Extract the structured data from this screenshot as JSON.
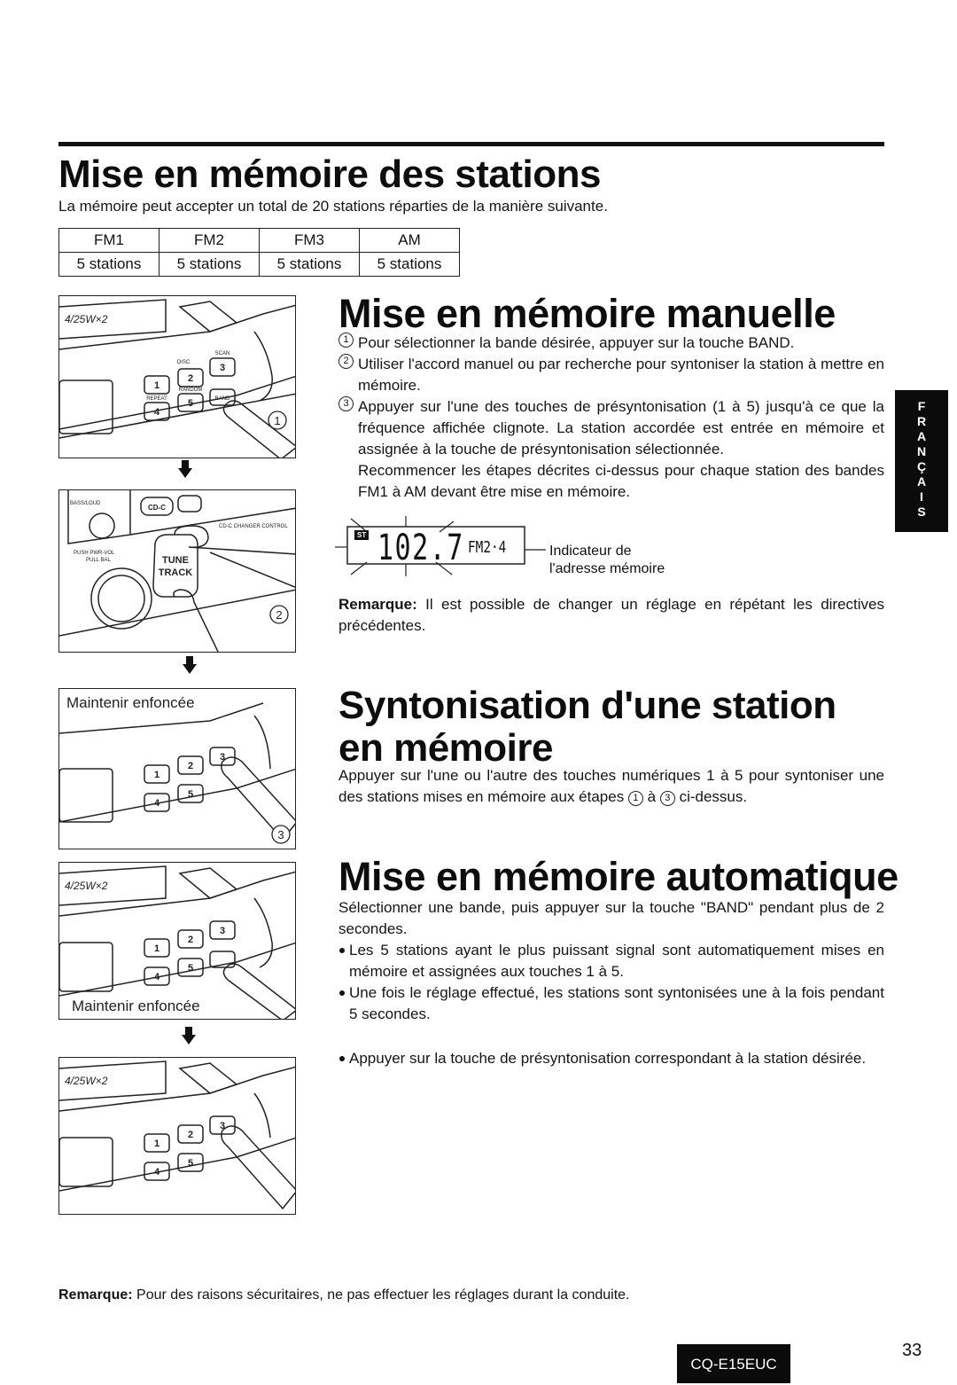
{
  "page": {
    "number": "33",
    "model_badge": "CQ-E15EUC",
    "language_tab": [
      "F",
      "R",
      "A",
      "N",
      "Ç",
      "A",
      "I",
      "S"
    ]
  },
  "section_stations": {
    "title": "Mise en mémoire des stations",
    "intro": "La mémoire peut accepter un total de 20 stations réparties de la manière suivante.",
    "table": {
      "headers": [
        "FM1",
        "FM2",
        "FM3",
        "AM"
      ],
      "values": [
        "5 stations",
        "5 stations",
        "5 stations",
        "5 stations"
      ]
    }
  },
  "section_manual": {
    "title": "Mise en mémoire manuelle",
    "steps": [
      {
        "num": "1",
        "text": "Pour sélectionner la bande désirée, appuyer sur la touche BAND."
      },
      {
        "num": "2",
        "text": "Utiliser l'accord manuel ou par recherche pour syntoniser la station à mettre en mémoire."
      },
      {
        "num": "3",
        "text": "Appuyer sur l'une des touches de présyntonisation  (1 à 5) jusqu'à ce que la fréquence affichée clignote. La station accordée est entrée en mémoire et assignée à la touche de présyntonisation sélectionnée."
      }
    ],
    "repeat_note": "Recommencer les étapes décrites ci-dessus pour chaque station des bandes FM1 à AM devant être mise en mémoire.",
    "display": {
      "st_indicator": "ST",
      "frequency": "102.7",
      "band_preset": "FM2·4",
      "callout_line1": "Indicateur de",
      "callout_line2": "l'adresse mémoire"
    },
    "remark_label": "Remarque:",
    "remark_text": " Il est possible de changer un réglage en répétant les directives précédentes."
  },
  "section_recall": {
    "title": "Syntonisation d'une station en mémoire",
    "text_before": "Appuyer sur l'une ou l'autre des touches numériques 1 à 5 pour syntoniser une des stations mises en mémoire aux étapes ",
    "step_from": "1",
    "text_middle": " à ",
    "step_to": "3",
    "text_after": " ci-dessus."
  },
  "section_auto": {
    "title": "Mise en mémoire automatique",
    "intro": "Sélectionner une bande, puis appuyer sur la touche \"BAND\" pendant plus de 2 secondes.",
    "bullets": [
      "Les 5 stations ayant le plus puissant signal sont automatiquement mises en mémoire et assignées aux touches 1 à 5.",
      "Une fois le réglage effectué, les stations sont syntonisées une à la fois pendant 5 secondes."
    ],
    "bullets2": [
      "Appuyer sur la touche de présyntonisation correspondant à la station désirée."
    ]
  },
  "footer_remark": {
    "label": "Remarque:",
    "text": " Pour des raisons sécuritaires, ne pas effectuer les réglages durant la conduite."
  },
  "illustrations": [
    {
      "step": "1",
      "caption": "",
      "keys": [
        "1",
        "2",
        "3",
        "4",
        "5"
      ],
      "key_labels": [
        "SCAN",
        "REPEAT",
        "RANDOM",
        "BAND",
        "DISC"
      ],
      "display_text": "4/25W×2"
    },
    {
      "step": "2",
      "caption": "",
      "labels": [
        "BASS/LOUD",
        "PUSH PWR-VOL",
        "PULL BAL",
        "TUNE",
        "TRACK",
        "CD-C",
        "CD-C CHANGER CONTROL"
      ]
    },
    {
      "step": "3",
      "caption": "Maintenir enfoncée",
      "keys": [
        "1",
        "2",
        "3",
        "4",
        "5"
      ]
    },
    {
      "step": "",
      "caption": "Maintenir enfoncée",
      "keys": [
        "1",
        "2",
        "3",
        "4",
        "5"
      ],
      "display_text": "4/25W×2"
    },
    {
      "step": "",
      "caption": "",
      "keys": [
        "1",
        "2",
        "3",
        "4",
        "5"
      ],
      "display_text": "4/25W×2"
    }
  ]
}
